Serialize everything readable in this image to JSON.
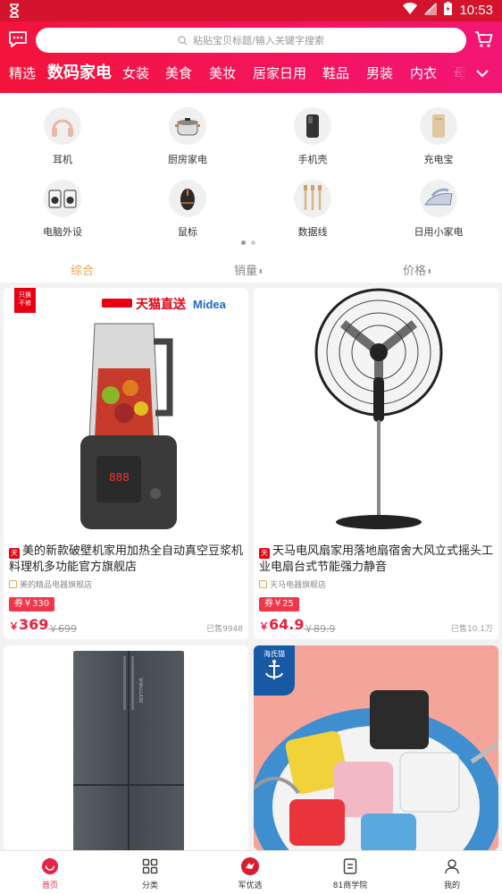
{
  "status": {
    "time": "10:53"
  },
  "search": {
    "placeholder": "粘贴宝贝标题/输入关键字搜索"
  },
  "tabs": [
    "精选",
    "数码家电",
    "女装",
    "美食",
    "美妆",
    "居家日用",
    "鞋品",
    "男装",
    "内衣",
    "母"
  ],
  "active_tab": "数码家电",
  "categories": [
    "耳机",
    "厨房家电",
    "手机壳",
    "充电宝",
    "电脑外设",
    "鼠标",
    "数据线",
    "日用小家电"
  ],
  "sort": {
    "comprehensive": "综合",
    "sales": "销量",
    "price": "价格",
    "sales_arrow": "⬍",
    "price_arrow": "⬍"
  },
  "products": [
    {
      "title": "美的新款破壁机家用加热全自动真空豆浆机料理机多功能官方旗舰店",
      "shop": "美的精品电器旗舰店",
      "coupon": "券￥330",
      "price_symbol": "￥",
      "price": "369",
      "original": "￥699",
      "sold": "已售9948",
      "banner_text": "天猫直送",
      "brand": "Midea",
      "corner_tag_1": "只换",
      "corner_tag_2": "不修"
    },
    {
      "title": "天马电风扇家用落地扇宿舍大风立式摇头工业电扇台式节能强力静音",
      "shop": "天马电器旗舰店",
      "coupon": "券￥25",
      "price_symbol": "￥",
      "price": "64.9",
      "original": "￥89.9",
      "sold": "已售10.1万"
    },
    {
      "title": "",
      "shop": "",
      "brand_text": "SHALLLION"
    },
    {
      "title": "",
      "shop": "",
      "corner_tag": "海氏锚"
    }
  ],
  "bottom_nav": [
    "首页",
    "分类",
    "军优选",
    "81商学院",
    "我的"
  ],
  "colors": {
    "brand_red": "#f2143a",
    "accent_pink": "#f21674",
    "sort_active": "#e8a24a",
    "price_red": "#e91f3d"
  }
}
